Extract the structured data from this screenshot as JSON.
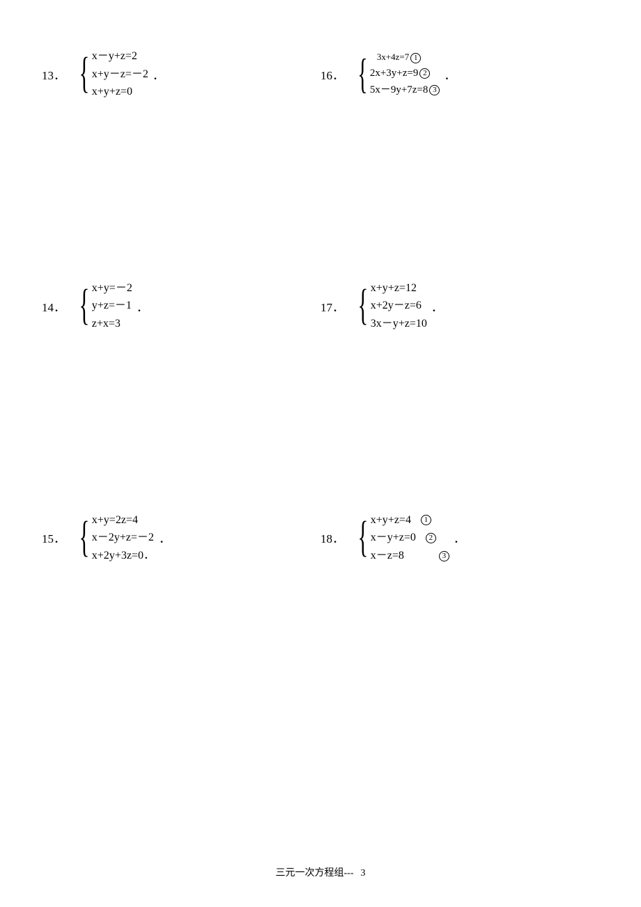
{
  "problems": {
    "p13": {
      "num": "13．",
      "eq1": "x－y+z=2",
      "eq2": "x+y－z=－2",
      "eq3": "x+y+z=0",
      "trail": "．"
    },
    "p16": {
      "num": "16．",
      "eq1": "3x+4z=7",
      "c1": "1",
      "eq2": "2x+3y+z=9",
      "c2": "2",
      "eq3": "5x－9y+7z=8",
      "c3": "3",
      "trail": "．"
    },
    "p14": {
      "num": "14．",
      "eq1": "x+y=－2",
      "eq2": "y+z=－1",
      "eq3": "z+x=3",
      "trail": "．"
    },
    "p17": {
      "num": "17．",
      "eq1": "x+y+z=12",
      "eq2": "x+2y－z=6",
      "eq3": "3x－y+z=10",
      "trail": "．"
    },
    "p15": {
      "num": "15．",
      "eq1": "x+y=2z=4",
      "eq2": "x－2y+z=－2",
      "eq3": "x+2y+3z=0．",
      "trail": "．"
    },
    "p18": {
      "num": "18．",
      "eq1": "x+y+z=4",
      "c1": "1",
      "eq2": "x－y+z=0",
      "c2": "2",
      "eq3": "x－z=8",
      "c3": "3",
      "trail": "．"
    }
  },
  "footer": {
    "text": "三元一次方程组---",
    "page": "3"
  }
}
